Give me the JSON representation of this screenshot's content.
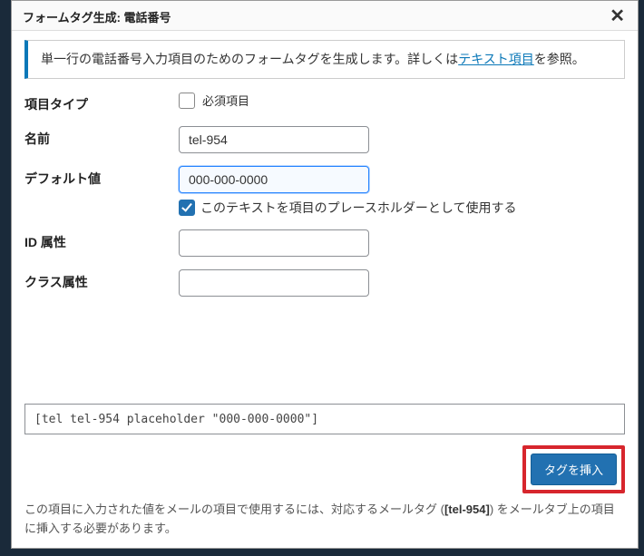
{
  "header": {
    "title": "フォームタグ生成: 電話番号"
  },
  "info": {
    "text_before_link": "単一行の電話番号入力項目のためのフォームタグを生成します。詳しくは",
    "link_text": "テキスト項目",
    "text_after_link": "を参照。"
  },
  "fields": {
    "type_label": "項目タイプ",
    "required_label": "必須項目",
    "name_label": "名前",
    "name_value": "tel-954",
    "default_label": "デフォルト値",
    "default_value": "000-000-0000",
    "placeholder_label": "このテキストを項目のプレースホルダーとして使用する",
    "id_label": "ID 属性",
    "id_value": "",
    "class_label": "クラス属性",
    "class_value": ""
  },
  "output": {
    "tag": "[tel tel-954 placeholder \"000-000-0000\"]",
    "insert_button": "タグを挿入"
  },
  "mail_hint": {
    "before_bold": "この項目に入力された値をメールの項目で使用するには、対応するメールタグ (",
    "bold": "[tel-954]",
    "after_bold": ") をメールタブ上の項目に挿入する必要があります。"
  }
}
